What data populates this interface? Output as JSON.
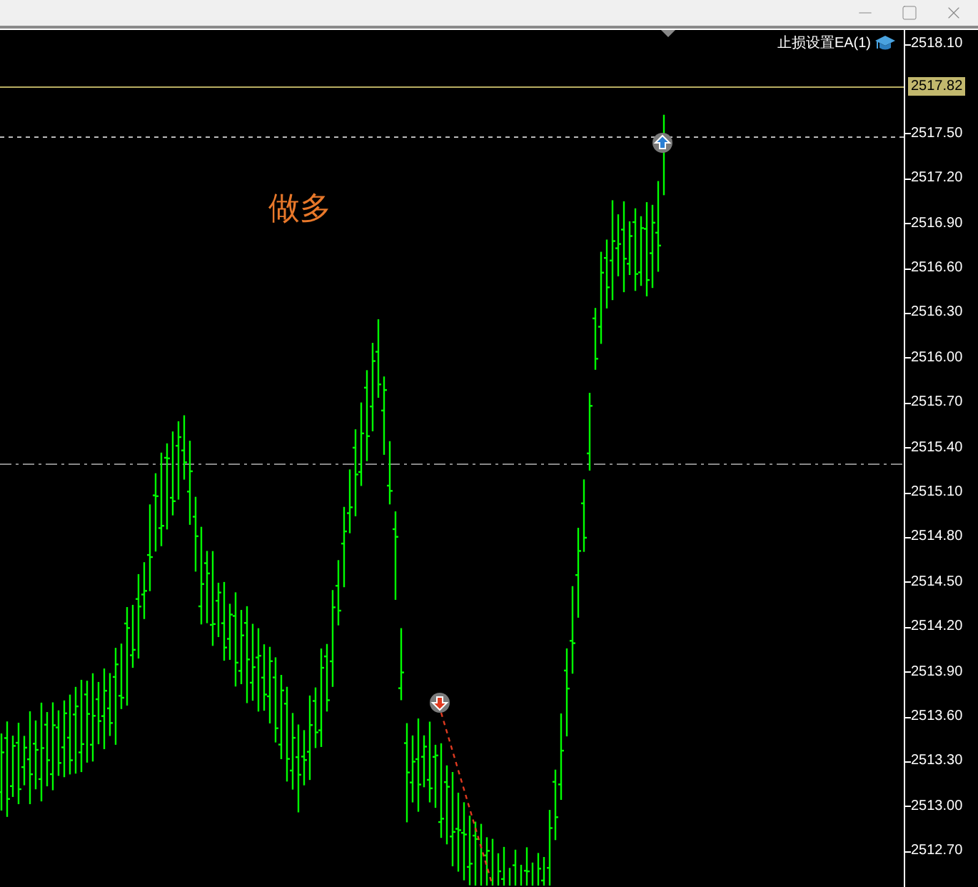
{
  "chart": {
    "signal_label": "做多",
    "expert_label": "止损设置EA(1)",
    "current_price": "2517.82",
    "price_axis": {
      "ticks": [
        "2518.10",
        "2517.50",
        "2517.20",
        "2516.90",
        "2516.60",
        "2516.30",
        "2516.00",
        "2515.70",
        "2515.40",
        "2515.10",
        "2514.80",
        "2514.50",
        "2514.20",
        "2513.90",
        "2513.60",
        "2513.30",
        "2513.00",
        "2512.70"
      ]
    },
    "trade_markers": [
      {
        "kind": "buy"
      },
      {
        "kind": "sell"
      }
    ]
  }
}
